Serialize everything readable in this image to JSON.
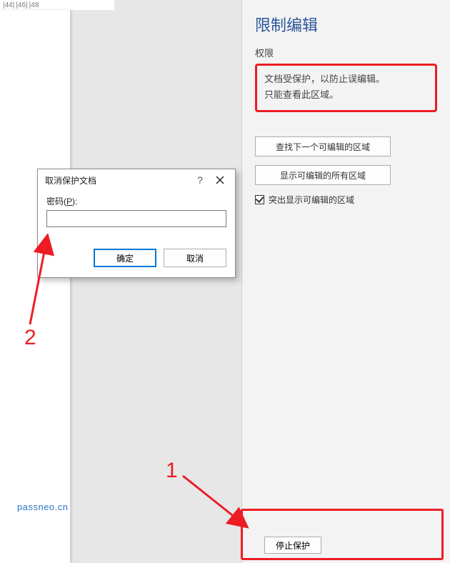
{
  "ruler": {
    "marks": [
      "|44|",
      "|46|",
      "|48"
    ]
  },
  "dialog": {
    "title": "取消保护文档",
    "help": "?",
    "password_label_pre": "密码(",
    "password_label_key": "P",
    "password_label_post": "):",
    "password_value": "",
    "ok": "确定",
    "cancel": "取消"
  },
  "panel": {
    "title": "限制编辑",
    "perm_head": "权限",
    "protect_line1": "文档受保护，以防止误编辑。",
    "protect_line2": "只能查看此区域。",
    "find_next": "查找下一个可编辑的区域",
    "show_all": "显示可编辑的所有区域",
    "highlight": "突出显示可编辑的区域",
    "stop": "停止保护"
  },
  "annotations": {
    "num1": "1",
    "num2": "2"
  },
  "watermark": "passneo.cn"
}
